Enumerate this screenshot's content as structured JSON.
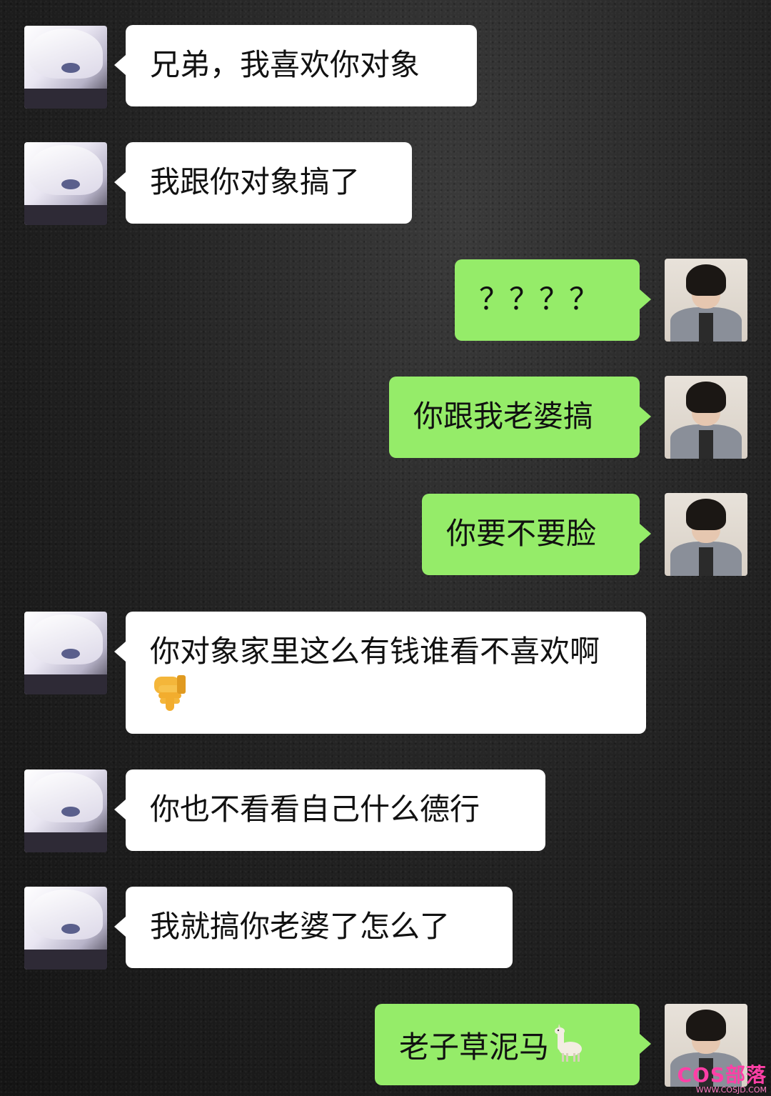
{
  "messages": [
    {
      "side": "left",
      "text": "兄弟，我喜欢你对象"
    },
    {
      "side": "left",
      "text": "我跟你对象搞了"
    },
    {
      "side": "right",
      "text": "？？？？"
    },
    {
      "side": "right",
      "text": "你跟我老婆搞"
    },
    {
      "side": "right",
      "text": "你要不要脸"
    },
    {
      "side": "left",
      "text": "你对象家里这么有钱谁看不喜欢啊",
      "emoji": "thumbs-down"
    },
    {
      "side": "left",
      "text": "你也不看看自己什么德行"
    },
    {
      "side": "left",
      "text": "我就搞你老婆了怎么了"
    },
    {
      "side": "right",
      "text": "老子草泥马",
      "emoji": "llama"
    }
  ],
  "colors": {
    "left_bubble": "#ffffff",
    "right_bubble": "#95ec69"
  },
  "watermark": {
    "title": "COS部落",
    "url": "WWW.COSJD.COM"
  }
}
